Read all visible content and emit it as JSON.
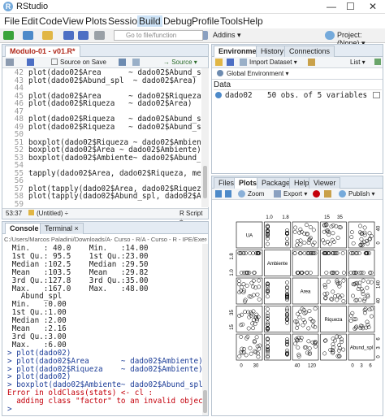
{
  "window": {
    "title": "RStudio",
    "minimize": "—",
    "maximize": "☐",
    "close": "✕"
  },
  "menu": [
    "File",
    "Edit",
    "Code",
    "View",
    "Plots",
    "Session",
    "Build",
    "Debug",
    "Profile",
    "Tools",
    "Help"
  ],
  "toolbar": {
    "goto_placeholder": "Go to file/function",
    "addins": "Addins ▾",
    "project": "Project: (None) ▾"
  },
  "editor": {
    "tab": "Modulo-01 - v01.R*",
    "source_on_save": "Source on Save",
    "source_btn": "→ Source ▾",
    "lines": [
      {
        "n": "42",
        "t": "plot(dado02$Area      ~ dado02$Abund_spl"
      },
      {
        "n": "43",
        "t": "plot(dado02$Abund_spl  ~ dado02$Area)"
      },
      {
        "n": "44",
        "t": ""
      },
      {
        "n": "45",
        "t": "plot(dado02$Area      ~ dado02$Riqueza)"
      },
      {
        "n": "46",
        "t": "plot(dado02$Riqueza   ~ dado02$Area)"
      },
      {
        "n": "47",
        "t": ""
      },
      {
        "n": "48",
        "t": "plot(dado02$Riqueza   ~ dado02$Abund_spl"
      },
      {
        "n": "49",
        "t": "plot(dado02$Riqueza   ~ dado02$Abund_sp"
      },
      {
        "n": "50",
        "t": ""
      },
      {
        "n": "51",
        "t": "boxplot(dado02$Riqueza ~ dado02$Ambient"
      },
      {
        "n": "52",
        "t": "boxplot(dado02$Area ~ dado02$Ambiente)"
      },
      {
        "n": "53",
        "t": "boxplot(dado02$Ambiente~ dado02$Abund_s"
      },
      {
        "n": "54",
        "t": ""
      },
      {
        "n": "55",
        "t": "tapply(dado02$Area, dado02$Riqueza, mea"
      },
      {
        "n": "56",
        "t": ""
      },
      {
        "n": "57",
        "t": "plot(tapply(dado02$Area, dado02$Riqueza,"
      },
      {
        "n": "58",
        "t": "plot(tapply(dado02$Abund_spl, dado02$Am"
      },
      {
        "n": "59",
        "t": ""
      }
    ],
    "status_pos": "53:37",
    "status_scope": "(Untitled) ÷",
    "status_type": "R Script ÷"
  },
  "console": {
    "tabs": [
      "Console",
      "Terminal ×"
    ],
    "path": "C:/Users/Marcos Paladini/Downloads/A- Curso - R/A - Curso - R - IPE/Exercic",
    "lines": [
      {
        "c": "out",
        "t": " Min.   : 40.0    Min.   :14.00"
      },
      {
        "c": "out",
        "t": " 1st Qu.: 95.5    1st Qu.:23.00"
      },
      {
        "c": "out",
        "t": " Median :102.5    Median :29.50"
      },
      {
        "c": "out",
        "t": " Mean   :103.5    Mean   :29.82"
      },
      {
        "c": "out",
        "t": " 3rd Qu.:127.8    3rd Qu.:35.00"
      },
      {
        "c": "out",
        "t": " Max.   :167.0    Max.   :48.00"
      },
      {
        "c": "out",
        "t": "   Abund_spl"
      },
      {
        "c": "out",
        "t": " Min.   :0.00"
      },
      {
        "c": "out",
        "t": " 1st Qu.:1.00"
      },
      {
        "c": "out",
        "t": " Median :2.00"
      },
      {
        "c": "out",
        "t": " Mean   :2.16"
      },
      {
        "c": "out",
        "t": " 3rd Qu.:3.00"
      },
      {
        "c": "out",
        "t": " Max.   :6.00"
      },
      {
        "c": "in",
        "t": "> plot(dado02)"
      },
      {
        "c": "in",
        "t": "> plot(dado02$Area       ~ dado02$Ambiente)"
      },
      {
        "c": "in",
        "t": "> plot(dado02$Riqueza    ~ dado02$Ambiente)"
      },
      {
        "c": "in",
        "t": "> plot(dado02)"
      },
      {
        "c": "in",
        "t": "> boxplot(dado02$Ambiente~ dado02$Abund_spl)"
      },
      {
        "c": "err",
        "t": "Error in oldClass(stats) <- cl :"
      },
      {
        "c": "err",
        "t": "  adding class \"factor\" to an invalid object"
      },
      {
        "c": "in",
        "t": ">"
      }
    ]
  },
  "environment": {
    "tabs": [
      "Environment",
      "History",
      "Connections"
    ],
    "import": "Import Dataset ▾",
    "list": "List ▾",
    "scope": "Global Environment ▾",
    "section": "Data",
    "rows": [
      {
        "name": "dado02",
        "value": "50 obs. of 5 variables"
      }
    ]
  },
  "files": {
    "tabs": [
      "Files",
      "Plots",
      "Packages",
      "Help",
      "Viewer"
    ],
    "zoom": "Zoom",
    "export": "Export ▾",
    "publish": "Publish ▾"
  },
  "chart_data": {
    "type": "scatter",
    "title": "",
    "variables": [
      "UA",
      "Ambiente",
      "Area",
      "Riqueza",
      "Abund_spl"
    ],
    "top_axis_ticks": {
      "Ambiente": [
        "1.0",
        "1.8"
      ],
      "Riqueza": [
        "15",
        "35"
      ]
    },
    "bottom_axis_ticks": {
      "UA": [
        "0",
        "30"
      ],
      "Area": [
        "40",
        "120"
      ],
      "Abund_spl": [
        "0",
        "3",
        "6"
      ]
    },
    "left_axis_ticks": {
      "Ambiente": [
        "1.0",
        "1.8"
      ],
      "Riqueza": [
        "15",
        "35"
      ]
    },
    "right_axis_ticks": {
      "UA": [
        "0",
        "40"
      ],
      "Area": [
        "40",
        "140"
      ],
      "Abund_spl": [
        "0",
        "3",
        "6"
      ]
    }
  }
}
